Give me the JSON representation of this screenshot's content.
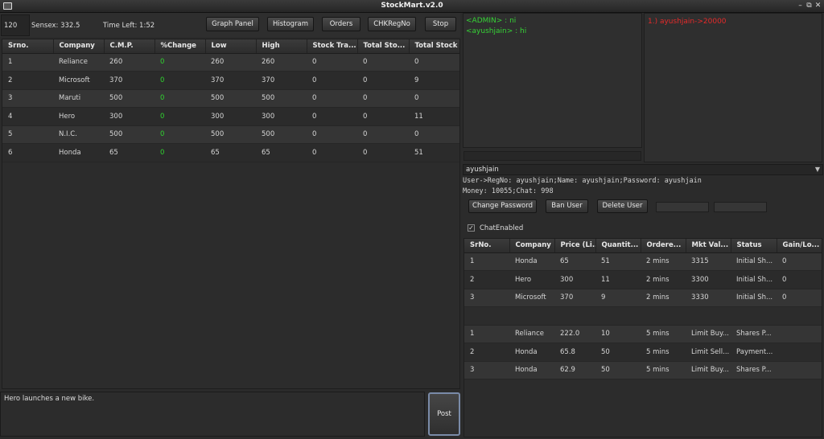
{
  "window": {
    "title": "StockMart.v2.0",
    "minimize": "–",
    "restore": "⧉",
    "close": "✕"
  },
  "top_bar": {
    "counter": "120",
    "sensex": "Sensex: 332.5",
    "time_left": "Time Left: 1:52",
    "buttons": {
      "graph_panel": "Graph Panel",
      "histogram": "Histogram",
      "orders": "Orders",
      "chk_regno": "CHKRegNo",
      "stop": "Stop"
    }
  },
  "stock_table": {
    "headers": [
      "Srno.",
      "Company",
      "C.M.P.",
      "%Change",
      "Low",
      "High",
      "Stock Tra...",
      "Total Sto...",
      "Total Stock"
    ],
    "rows": [
      [
        "1",
        "Reliance",
        "260",
        "0",
        "260",
        "260",
        "0",
        "0",
        "0"
      ],
      [
        "2",
        "Microsoft",
        "370",
        "0",
        "370",
        "370",
        "0",
        "0",
        "9"
      ],
      [
        "3",
        "Maruti",
        "500",
        "0",
        "500",
        "500",
        "0",
        "0",
        "0"
      ],
      [
        "4",
        "Hero",
        "300",
        "0",
        "300",
        "300",
        "0",
        "0",
        "11"
      ],
      [
        "5",
        "N.I.C.",
        "500",
        "0",
        "500",
        "500",
        "0",
        "0",
        "0"
      ],
      [
        "6",
        "Honda",
        "65",
        "0",
        "65",
        "65",
        "0",
        "0",
        "51"
      ]
    ]
  },
  "news": {
    "text": "Hero launches a new bike.",
    "post_label": "Post"
  },
  "chat": {
    "lines": [
      "<ADMIN> : ni",
      "<ayushjain> : hi"
    ]
  },
  "alerts": {
    "lines": [
      "1.) ayushjain->20000"
    ]
  },
  "user": {
    "selected": "ayushjain",
    "info_line1": "User->RegNo: ayushjain;Name: ayushjain;Password: ayushjain",
    "info_line2": "Money: 10055;Chat: 998",
    "buttons": {
      "change_password": "Change Password",
      "ban_user": "Ban User",
      "delete_user": "Delete User"
    },
    "chat_enabled_label": "ChatEnabled",
    "chat_enabled_mark": "✓"
  },
  "portfolio_table": {
    "headers": [
      "SrNo.",
      "Company",
      "Price (Li...",
      "Quantit...",
      "Ordere...",
      "Mkt Val...",
      "Status",
      "Gain/Lo..."
    ],
    "holdings": [
      [
        "1",
        "Honda",
        "65",
        "51",
        "2 mins",
        "3315",
        "Initial Sh...",
        "0"
      ],
      [
        "2",
        "Hero",
        "300",
        "11",
        "2 mins",
        "3300",
        "Initial Sh...",
        "0"
      ],
      [
        "3",
        "Microsoft",
        "370",
        "9",
        "2 mins",
        "3330",
        "Initial Sh...",
        "0"
      ]
    ],
    "orders": [
      [
        "1",
        "Reliance",
        "222.0",
        "10",
        "5 mins",
        "Limit Buy...",
        "Shares P...",
        ""
      ],
      [
        "2",
        "Honda",
        "65.8",
        "50",
        "5 mins",
        "Limit Sell...",
        "Payment...",
        ""
      ],
      [
        "3",
        "Honda",
        "62.9",
        "50",
        "5 mins",
        "Limit Buy...",
        "Shares P...",
        ""
      ]
    ]
  },
  "colors": {
    "positive": "#2fd52f",
    "alert": "#e52a2a",
    "chat": "#36d336"
  },
  "icons": [
    "app-icon",
    "dropdown-arrow-icon",
    "checkmark-icon"
  ]
}
